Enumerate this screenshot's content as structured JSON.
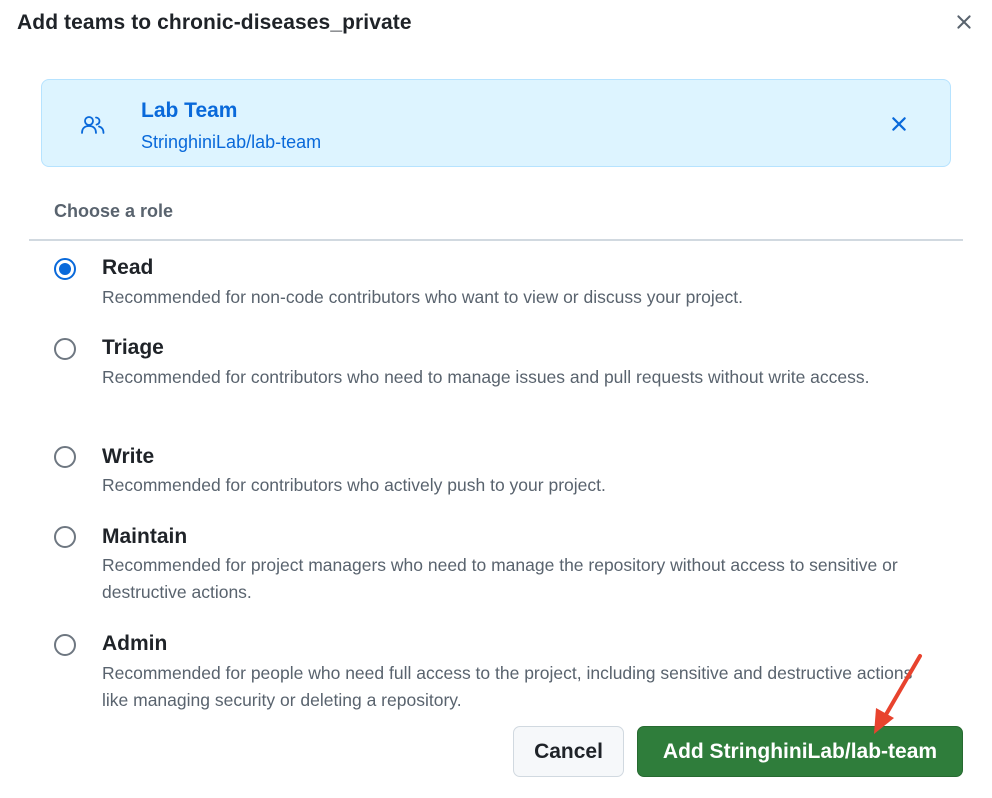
{
  "dialog": {
    "title": "Add teams to chronic-diseases_private",
    "close_icon": "close-icon"
  },
  "team": {
    "name": "Lab Team",
    "slug": "StringhiniLab/lab-team",
    "icon": "people-icon",
    "remove_icon": "close-icon"
  },
  "roles_section": {
    "label": "Choose a role",
    "selected": "Read",
    "roles": [
      {
        "name": "Read",
        "description": "Recommended for non-code contributors who want to view or discuss your project."
      },
      {
        "name": "Triage",
        "description": "Recommended for contributors who need to manage issues and pull requests without write access."
      },
      {
        "name": "Write",
        "description": "Recommended for contributors who actively push to your project."
      },
      {
        "name": "Maintain",
        "description": "Recommended for project managers who need to manage the repository without access to sensitive or destructive actions."
      },
      {
        "name": "Admin",
        "description": "Recommended for people who need full access to the project, including sensitive and destructive actions like managing security or deleting a repository."
      }
    ]
  },
  "actions": {
    "cancel_label": "Cancel",
    "add_label": "Add StringhiniLab/lab-team"
  },
  "colors": {
    "accent_blue": "#0969da",
    "card_background": "#ddf4ff",
    "primary_button": "#2f7d3b",
    "annotation_arrow": "#e8432e"
  }
}
